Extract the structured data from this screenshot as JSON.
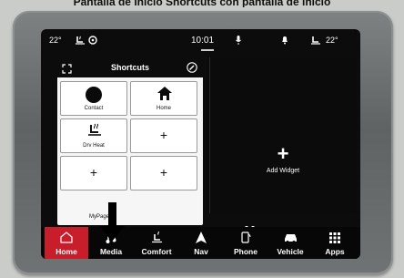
{
  "caption": "Pantalla de Inicio Shortcuts con pantalla de inicio",
  "status_bar": {
    "left_temp": "22°",
    "time": "10:01",
    "right_temp": "22°"
  },
  "shortcuts_panel": {
    "title": "Shortcuts",
    "tiles": [
      {
        "label": "Contact",
        "icon": "contact-dot-icon"
      },
      {
        "label": "Home",
        "icon": "house-icon"
      },
      {
        "label": "Drv Heat",
        "icon": "heated-seat-icon"
      },
      {
        "label": "+",
        "icon": "plus"
      },
      {
        "label": "+",
        "icon": "plus"
      },
      {
        "label": "+",
        "icon": "plus"
      }
    ],
    "footer": "MyPages"
  },
  "widget_panel": {
    "plus": "+",
    "label": "Add Widget"
  },
  "nav_bar": {
    "items": [
      {
        "label": "Home",
        "icon": "home-icon",
        "active": true
      },
      {
        "label": "Media",
        "icon": "music-note-icon",
        "active": false
      },
      {
        "label": "Comfort",
        "icon": "seat-heat-icon",
        "active": false
      },
      {
        "label": "Nav",
        "icon": "navigation-arrow-icon",
        "active": false
      },
      {
        "label": "Phone",
        "icon": "phone-icon",
        "active": false
      },
      {
        "label": "Vehicle",
        "icon": "car-icon",
        "active": false
      },
      {
        "label": "Apps",
        "icon": "apps-grid-icon",
        "active": false
      }
    ]
  },
  "colors": {
    "active_nav": "#c81e2c",
    "screen_bg": "#0c0c0c",
    "bezel": "#6a6d6e"
  }
}
